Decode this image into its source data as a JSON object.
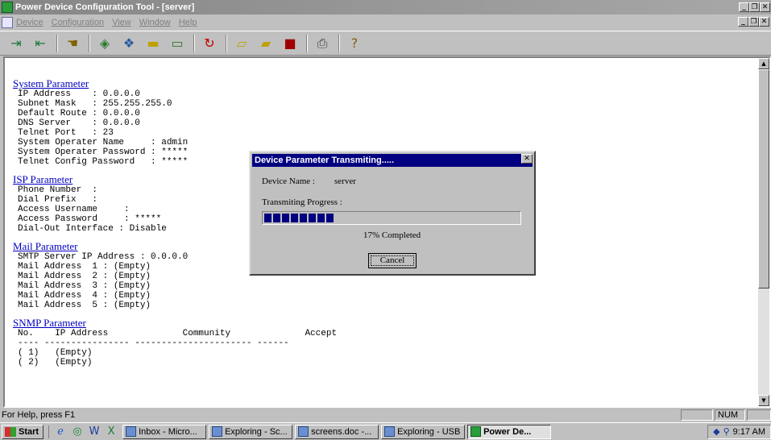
{
  "window": {
    "title": "Power Device Configuration Tool - [server]"
  },
  "menu": {
    "items": [
      "Device",
      "Configuration",
      "View",
      "Window",
      "Help"
    ]
  },
  "toolbar": {
    "icons": [
      "connect-icon",
      "disconnect-icon",
      "hand-icon",
      "device-icon",
      "network-icon",
      "card-icon",
      "monitor-icon",
      "refresh-icon",
      "open-folder-icon",
      "folder-icon",
      "save-icon",
      "print-icon",
      "help-icon"
    ]
  },
  "content": {
    "system": {
      "title": "System Parameter",
      "lines": [
        "IP Address    : 0.0.0.0",
        "Subnet Mask   : 255.255.255.0",
        "Default Route : 0.0.0.0",
        "DNS Server    : 0.0.0.0",
        "Telnet Port   : 23",
        "System Operater Name     : admin",
        "System Operater Password : *****",
        "Telnet Config Password   : *****"
      ]
    },
    "isp": {
      "title": "ISP Parameter",
      "lines": [
        "Phone Number  :",
        "Dial Prefix   :",
        "Access Username     :",
        "Access Password     : *****",
        "Dial-Out Interface : Disable"
      ]
    },
    "mail": {
      "title": "Mail Parameter",
      "lines": [
        "SMTP Server IP Address : 0.0.0.0",
        "Mail Address  1 : (Empty)",
        "Mail Address  2 : (Empty)",
        "Mail Address  3 : (Empty)",
        "Mail Address  4 : (Empty)",
        "Mail Address  5 : (Empty)"
      ]
    },
    "snmp": {
      "title": "SNMP Parameter",
      "lines": [
        "No.    IP Address              Community              Accept",
        "---- ---------------- ---------------------- ------",
        "( 1)   (Empty)",
        "( 2)   (Empty)"
      ]
    }
  },
  "dialog": {
    "title": "Device Parameter Transmiting.....",
    "device_name_label": "Device Name :",
    "device_name_value": "server",
    "progress_label": "Transmiting Progress :",
    "progress_fraction": 0.28,
    "completed_text": "17% Completed",
    "cancel_label": "Cancel"
  },
  "status": {
    "help": "For Help, press F1",
    "num": "NUM"
  },
  "taskbar": {
    "start": "Start",
    "tasks": [
      {
        "label": "Inbox - Micro...",
        "active": false
      },
      {
        "label": "Exploring - Sc...",
        "active": false
      },
      {
        "label": "screens.doc -...",
        "active": false
      },
      {
        "label": "Exploring - USB",
        "active": false
      },
      {
        "label": "Power De...",
        "active": true
      }
    ],
    "clock": "9:17 AM"
  }
}
